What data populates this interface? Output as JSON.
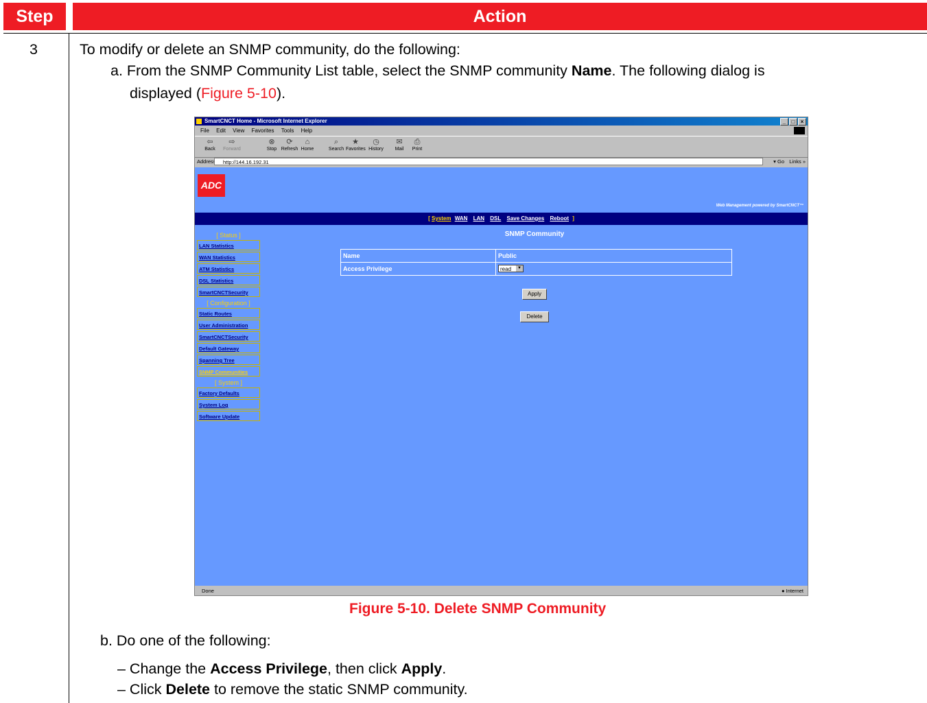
{
  "table": {
    "header_step": "Step",
    "header_action": "Action",
    "step_number": "3"
  },
  "content": {
    "intro": "To modify or delete an SNMP community, do the following:",
    "a_prefix": "a. From the SNMP Community List table, select the SNMP community ",
    "a_bold": "Name",
    "a_suffix": ". The following dialog is",
    "a_line2_prefix": "displayed (",
    "a_figref": "Figure 5-10",
    "a_line2_suffix": ").",
    "figure_caption": "Figure 5-10. Delete SNMP Community",
    "b_intro": "b. Do one of the following:",
    "bullet1_prefix": "– Change the ",
    "bullet1_bold1": "Access Privilege",
    "bullet1_mid": ", then click ",
    "bullet1_bold2": "Apply",
    "bullet1_suffix": ".",
    "bullet2_prefix": "– Click ",
    "bullet2_bold": "Delete",
    "bullet2_suffix": " to remove the static SNMP community."
  },
  "browser": {
    "title": "SmartCNCT Home - Microsoft Internet Explorer",
    "menu": [
      "File",
      "Edit",
      "View",
      "Favorites",
      "Tools",
      "Help"
    ],
    "toolbar": [
      "Back",
      "Forward",
      "Stop",
      "Refresh",
      "Home",
      "Search",
      "Favorites",
      "History",
      "Mail",
      "Print"
    ],
    "address_label": "Address",
    "address": "http://144.16.192.31",
    "go": "Go",
    "links": "Links »",
    "status_left": "Done",
    "status_zone": "Internet"
  },
  "webpage": {
    "logo": "ADC",
    "powered": "Web Management powered by SmartCNCT™",
    "nav": {
      "current": "System",
      "links": [
        "WAN",
        "LAN",
        "DSL",
        "Save Changes",
        "Reboot"
      ]
    },
    "sidebar": {
      "status_header": "[ Status ]",
      "status_items": [
        "LAN Statistics",
        "WAN Statistics",
        "ATM Statistics",
        "DSL Statistics",
        "SmartCNCTSecurity"
      ],
      "config_header": "[ Configuration ]",
      "config_items": [
        "Static Routes",
        "User Administration",
        "SmartCNCTSecurity",
        "Default Gateway",
        "Spanning Tree",
        "SNMP Communities"
      ],
      "system_header": "[ System ]",
      "system_items": [
        "Factory Defaults",
        "System Log",
        "Software Update"
      ]
    },
    "panel_title": "SNMP Community",
    "name_label": "Name",
    "name_value": "Public",
    "access_label": "Access Privilege",
    "access_value": "read",
    "apply_button": "Apply",
    "delete_button": "Delete"
  },
  "colors": {
    "header_red": "#ee1c24",
    "page_blue": "#6699ff",
    "nav_navy": "#000080",
    "highlight_yellow": "#ffd200"
  }
}
